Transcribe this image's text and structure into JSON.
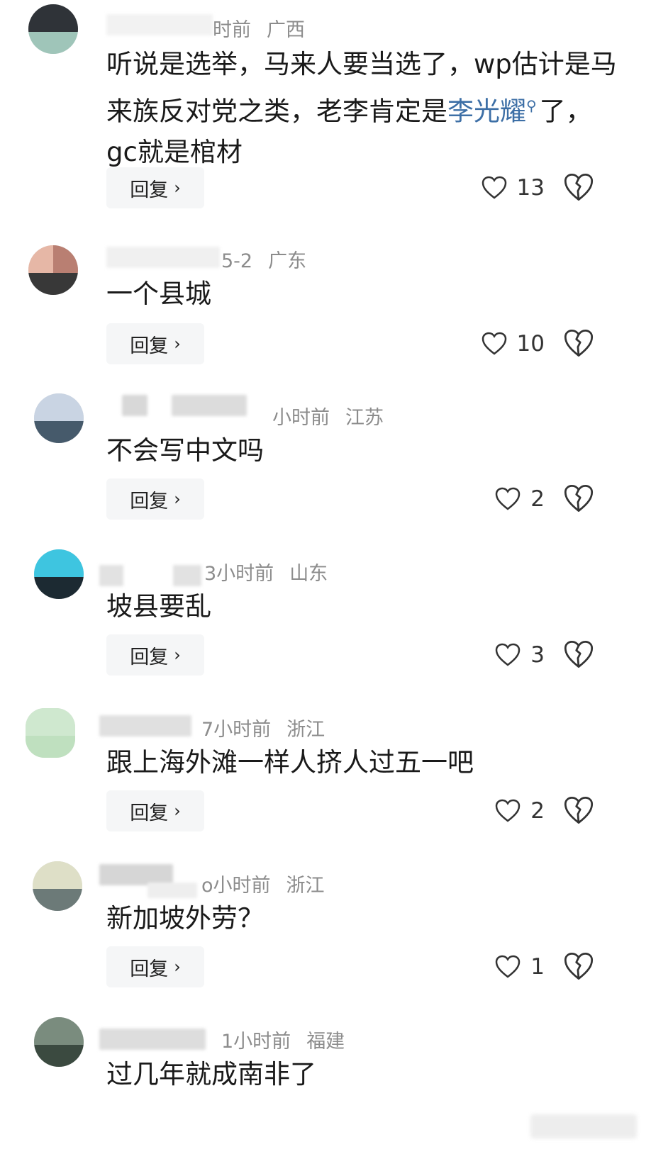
{
  "comments": [
    {
      "time": "时前",
      "location": "广西",
      "text_pre": "听说是选举，马来人要当选了，wp估计是马来族反对党之类，老李肯定是",
      "link": "李光耀",
      "text_post": "了，gc就是棺材",
      "reply": "回复",
      "likes": "13",
      "avatar": [
        "#2f3338",
        "#9fc5b9"
      ]
    },
    {
      "time": "5-2",
      "location": "广东",
      "text": "一个县城",
      "reply": "回复",
      "likes": "10",
      "avatar": [
        "#e6b7a6",
        "#383838"
      ]
    },
    {
      "time": "小时前",
      "location": "江苏",
      "text": "不会写中文吗",
      "reply": "回复",
      "likes": "2",
      "avatar": [
        "#c9d4e3",
        "#465a6b"
      ]
    },
    {
      "time": "3小时前",
      "location": "山东",
      "text": "坡县要乱",
      "reply": "回复",
      "likes": "3",
      "avatar": [
        "#3ec5e0",
        "#1c2a32"
      ]
    },
    {
      "time": "7小时前",
      "location": "浙江",
      "text": "跟上海外滩一样人挤人过五一吧",
      "reply": "回复",
      "likes": "2",
      "avatar": [
        "#cfe8cf",
        "#bfe0bf"
      ]
    },
    {
      "time": "o小时前",
      "location": "浙江",
      "text": "新加坡外劳？",
      "reply": "回复",
      "likes": "1",
      "avatar": [
        "#dedfc7",
        "#6c7a78"
      ]
    },
    {
      "time": "1小时前",
      "location": "福建",
      "text": "过几年就成南非了",
      "avatar": [
        "#7a8c7e",
        "#3b4a40"
      ]
    }
  ]
}
